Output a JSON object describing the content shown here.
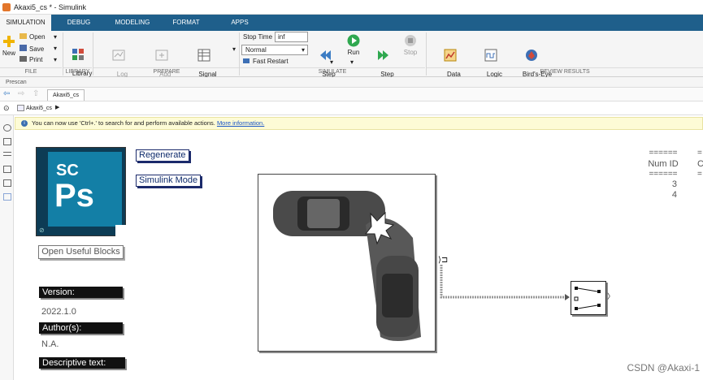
{
  "window": {
    "title": "Akaxi5_cs * - Simulink"
  },
  "tabs": [
    "SIMULATION",
    "DEBUG",
    "MODELING",
    "FORMAT",
    "APPS"
  ],
  "ribbon": {
    "file": {
      "new": "New",
      "open": "Open",
      "save": "Save",
      "print": "Print",
      "group": "FILE"
    },
    "library": {
      "browser": "Library\nBrowser",
      "group": "LIBRARY"
    },
    "prepare": {
      "log_signals": "Log\nSignals",
      "add_viewer": "Add\nViewer",
      "signal_table": "Signal\nTable",
      "group": "PREPARE"
    },
    "simulate": {
      "stop_time_label": "Stop Time",
      "stop_time_value": "inf",
      "mode": "Normal",
      "fast_restart": "Fast Restart",
      "step_back": "Step\nBack",
      "run": "Run",
      "step_forward": "Step\nForward",
      "stop": "Stop",
      "group": "SIMULATE"
    },
    "review": {
      "data_inspector": "Data\nInspector",
      "logic_analyzer": "Logic\nAnalyzer",
      "birds_eye": "Bird's-Eye\nScope",
      "group": "REVIEW RESULTS"
    }
  },
  "prescan_label": "Prescan",
  "doc_tab": "Akaxi5_cs",
  "breadcrumb": "Akaxi5_cs",
  "info": {
    "message": "You can now use 'Ctrl+.' to search for and perform available actions.",
    "link": "More information."
  },
  "canvas": {
    "logo_text_top": "SC",
    "logo_text_main": "Ps",
    "regenerate": "Regenerate",
    "simulink_mode": "Simulink Mode",
    "open_useful_blocks": "Open Useful Blocks",
    "version_label": "Version:",
    "version_value": "2022.1.0",
    "author_label": "Author(s):",
    "author_value": "N.A.",
    "descriptive_label": "Descriptive text:",
    "table": {
      "sep": "======",
      "header": "Num ID",
      "rows": [
        "3",
        "4"
      ],
      "partial_sep": "=",
      "partial_header": "C"
    }
  },
  "watermark": "CSDN @Akaxi-1"
}
